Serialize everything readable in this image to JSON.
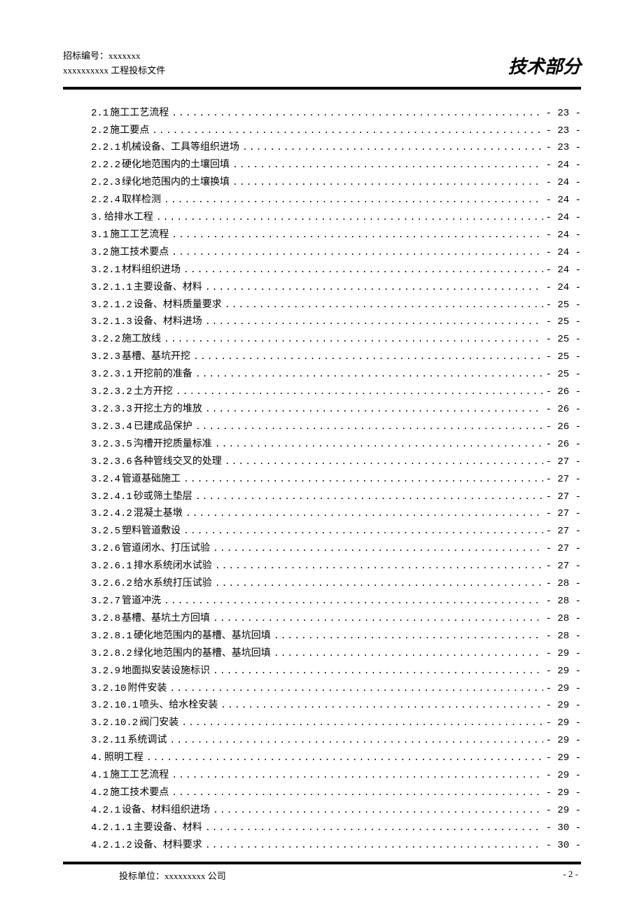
{
  "header": {
    "bid_no_label": "招标编号：",
    "bid_no_value": "xxxxxxx",
    "doc_title": "xxxxxxxxxx 工程投标文件",
    "section_title": "技术部分"
  },
  "footer": {
    "bidder_label": "投标单位：",
    "bidder_value": "xxxxxxxxx 公司",
    "page_label": "- 2 -"
  },
  "toc": [
    {
      "num": "2.1",
      "title": "施工工艺流程",
      "page": "- 23 -"
    },
    {
      "num": "2.2",
      "title": "施工要点",
      "page": "- 23 -"
    },
    {
      "num": "2.2.1",
      "title": "机械设备、工具等组织进场",
      "page": "- 23 -"
    },
    {
      "num": "2.2.2",
      "title": "硬化地范围内的土壤回填",
      "page": "- 24 -"
    },
    {
      "num": "2.2.3",
      "title": "绿化地范围内的土壤换填",
      "page": "- 24 -"
    },
    {
      "num": "2.2.4",
      "title": "取样检测",
      "page": "- 24 -"
    },
    {
      "num": "3.",
      "title": "给排水工程",
      "page": "- 24 -"
    },
    {
      "num": "3.1",
      "title": "施工工艺流程",
      "page": "- 24 -"
    },
    {
      "num": "3.2",
      "title": "施工技术要点",
      "page": "- 24 -"
    },
    {
      "num": "3.2.1",
      "title": "材料组织进场",
      "page": "- 24 -"
    },
    {
      "num": "3.2.1.1",
      "title": "主要设备、材料",
      "page": "- 24 -"
    },
    {
      "num": "3.2.1.2",
      "title": "设备、材料质量要求",
      "page": "- 25 -"
    },
    {
      "num": "3.2.1.3",
      "title": "设备、材料进场",
      "page": "- 25 -"
    },
    {
      "num": "3.2.2",
      "title": "施工放线",
      "page": "- 25 -"
    },
    {
      "num": "3.2.3",
      "title": "基槽、基坑开挖",
      "page": "- 25 -"
    },
    {
      "num": "3.2.3.1",
      "title": "开挖前的准备",
      "page": "- 25 -"
    },
    {
      "num": "3.2.3.2",
      "title": "土方开挖",
      "page": "- 26 -"
    },
    {
      "num": "3.2.3.3",
      "title": "开挖土方的堆放",
      "page": "- 26 -"
    },
    {
      "num": "3.2.3.4",
      "title": "已建成品保护",
      "page": "- 26 -"
    },
    {
      "num": "3.2.3.5",
      "title": "沟槽开挖质量标准",
      "page": "- 26 -"
    },
    {
      "num": "3.2.3.6",
      "title": "各种管线交叉的处理",
      "page": "- 27 -"
    },
    {
      "num": "3.2.4",
      "title": "管道基础施工",
      "page": "- 27 -"
    },
    {
      "num": "3.2.4.1",
      "title": "砂或筛土垫层",
      "page": "- 27 -"
    },
    {
      "num": "3.2.4.2",
      "title": "混凝土基墩",
      "page": "- 27 -"
    },
    {
      "num": "3.2.5",
      "title": "塑料管道敷设",
      "page": "- 27 -"
    },
    {
      "num": "3.2.6",
      "title": "管道闭水、打压试验",
      "page": "- 27 -"
    },
    {
      "num": "3.2.6.1",
      "title": "排水系统闭水试验",
      "page": "- 27 -"
    },
    {
      "num": "3.2.6.2",
      "title": "给水系统打压试验",
      "page": "- 28 -"
    },
    {
      "num": "3.2.7",
      "title": "管道冲洗",
      "page": "- 28 -"
    },
    {
      "num": "3.2.8",
      "title": "基槽、基坑土方回填",
      "page": "- 28 -"
    },
    {
      "num": "3.2.8.1",
      "title": "硬化地范围内的基槽、基坑回填",
      "page": "- 28 -"
    },
    {
      "num": "3.2.8.2",
      "title": "绿化地范围内的基槽、基坑回填",
      "page": "- 29 -"
    },
    {
      "num": "3.2.9",
      "title": "地面拟安装设施标识",
      "page": "- 29 -"
    },
    {
      "num": "3.2.10",
      "title": "附件安装",
      "page": "- 29 -"
    },
    {
      "num": "3.2.10.1",
      "title": "喷头、给水栓安装",
      "page": "- 29 -"
    },
    {
      "num": "3.2.10.2",
      "title": "阀门安装",
      "page": "- 29 -"
    },
    {
      "num": "3.2.11",
      "title": "系统调试",
      "page": "- 29 -"
    },
    {
      "num": "4.",
      "title": "照明工程",
      "page": "- 29 -"
    },
    {
      "num": "4.1",
      "title": "施工工艺流程",
      "page": "- 29 -"
    },
    {
      "num": "4.2",
      "title": "施工技术要点",
      "page": "- 29 -"
    },
    {
      "num": "4.2.1",
      "title": "设备、材料组织进场",
      "page": "- 29 -"
    },
    {
      "num": "4.2.1.1",
      "title": "主要设备、材料",
      "page": "- 30 -"
    },
    {
      "num": "4.2.1.2",
      "title": "设备、材料要求",
      "page": "- 30 -"
    }
  ]
}
